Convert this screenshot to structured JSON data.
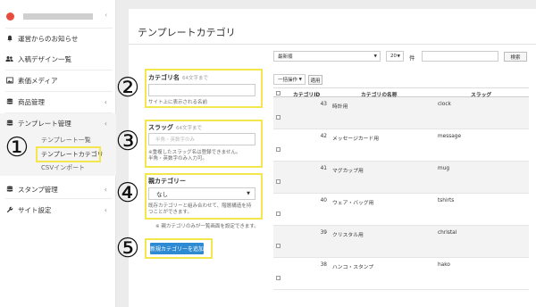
{
  "sidebar": {
    "items": [
      {
        "label": "運営からのお知らせ",
        "icon": "bell-icon"
      },
      {
        "label": "入稿デザイン一覧",
        "icon": "users-icon"
      },
      {
        "label": "素価メディア",
        "icon": "image-icon"
      },
      {
        "label": "商品管理",
        "icon": "database-icon"
      },
      {
        "label": "テンプレート管理",
        "icon": "database-icon"
      },
      {
        "label": "スタンプ管理",
        "icon": "database-icon"
      },
      {
        "label": "サイト設定",
        "icon": "wrench-icon"
      }
    ],
    "subitems": [
      {
        "label": "テンプレート一覧"
      },
      {
        "label": "テンプレートカテゴリ"
      },
      {
        "label": "CSVインポート"
      }
    ]
  },
  "page": {
    "title": "テンプレートカテゴリ"
  },
  "form": {
    "name_label": "カテゴリ名",
    "name_hint": "64文字まで",
    "name_help": "サイト上に表示される名前",
    "slug_label": "スラッグ",
    "slug_hint": "64文字まで",
    "slug_placeholder": "半角・英数字のみ",
    "slug_help_1": "※重複したスラッグ名は登録できません。",
    "slug_help_2": "半角・英数字のみ入力可。",
    "parent_label": "親カテゴリー",
    "parent_value": "なし",
    "parent_help_1": "既存カテゴリーと組み合わせて、階層構造を持",
    "parent_help_2": "つことができます。",
    "parent_note": "※ 親カテゴリのみが一覧画面を設定できます。",
    "add_button": "新規カテゴリーを追加"
  },
  "annotations": [
    "①",
    "②",
    "③",
    "④",
    "⑤"
  ],
  "toolbar": {
    "sort_value": "最新順",
    "per_page_value": "20",
    "per_page_unit": "件",
    "search_button": "検索",
    "bulk_action": "一括操作",
    "apply_button": "適用"
  },
  "table": {
    "headers": [
      "カテゴリID",
      "カテゴリの名称",
      "スラッグ"
    ],
    "rows": [
      {
        "id": "43",
        "name": "時計用",
        "slug": "clock"
      },
      {
        "id": "42",
        "name": "メッセージカード用",
        "slug": "message"
      },
      {
        "id": "41",
        "name": "マグカップ用",
        "slug": "mug"
      },
      {
        "id": "40",
        "name": "ウェア・バッグ用",
        "slug": "tshirts"
      },
      {
        "id": "39",
        "name": "クリスタル用",
        "slug": "christal"
      },
      {
        "id": "38",
        "name": "ハンコ・スタンプ",
        "slug": "hako"
      }
    ]
  },
  "colors": {
    "highlight": "#f4e74e",
    "primary": "#2e8bd3",
    "avatar": "#e74c3c"
  }
}
